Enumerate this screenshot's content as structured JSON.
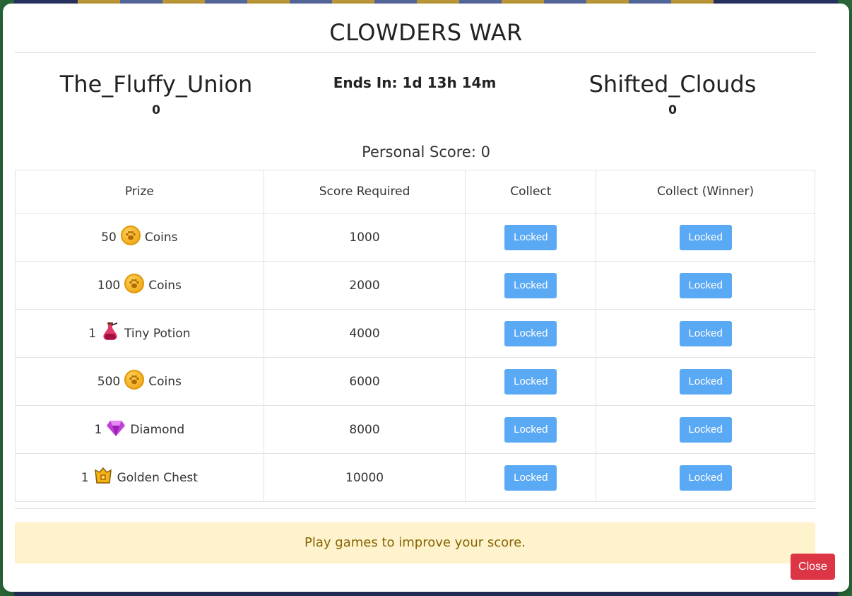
{
  "title": "CLOWDERS WAR",
  "teams": {
    "left": {
      "name": "The_Fluffy_Union",
      "score": "0"
    },
    "right": {
      "name": "Shifted_Clouds",
      "score": "0"
    },
    "ends_in": "Ends In: 1d 13h 14m"
  },
  "personal_score": "Personal Score: 0",
  "table": {
    "headers": [
      "Prize",
      "Score Required",
      "Collect",
      "Collect (Winner)"
    ],
    "rows": [
      {
        "qty": "50",
        "icon": "paw-coin-icon",
        "item": "Coins",
        "score": "1000",
        "collect": "Locked",
        "collect_winner": "Locked"
      },
      {
        "qty": "100",
        "icon": "paw-coin-icon",
        "item": "Coins",
        "score": "2000",
        "collect": "Locked",
        "collect_winner": "Locked"
      },
      {
        "qty": "1",
        "icon": "potion-icon",
        "item": "Tiny Potion",
        "score": "4000",
        "collect": "Locked",
        "collect_winner": "Locked"
      },
      {
        "qty": "500",
        "icon": "paw-coin-icon",
        "item": "Coins",
        "score": "6000",
        "collect": "Locked",
        "collect_winner": "Locked"
      },
      {
        "qty": "1",
        "icon": "diamond-icon",
        "item": "Diamond",
        "score": "8000",
        "collect": "Locked",
        "collect_winner": "Locked"
      },
      {
        "qty": "1",
        "icon": "golden-chest-icon",
        "item": "Golden Chest",
        "score": "10000",
        "collect": "Locked",
        "collect_winner": "Locked"
      }
    ]
  },
  "alert": "Play games to improve your score.",
  "close_label": "Close",
  "colors": {
    "locked_button": "#5aa9f5",
    "close_button": "#dc3545",
    "alert_bg": "#fff3cd",
    "alert_text": "#856404"
  }
}
